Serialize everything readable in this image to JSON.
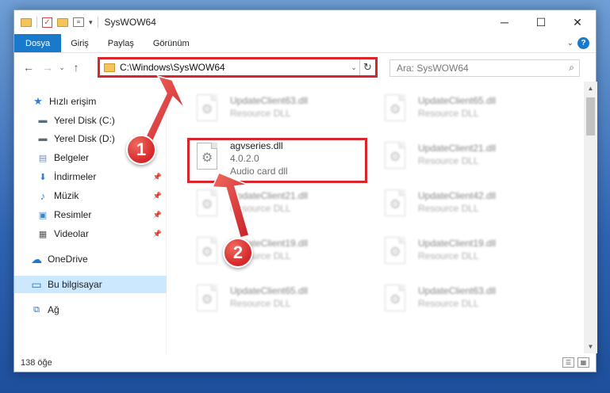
{
  "window": {
    "title": "SysWOW64",
    "controls": {
      "minimize": "─",
      "maximize": "☐",
      "close": "✕"
    }
  },
  "quick_access_toolbar": {
    "props": "≡",
    "caret": "▾"
  },
  "ribbon": {
    "tabs": [
      "Dosya",
      "Giriş",
      "Paylaş",
      "Görünüm"
    ],
    "expand": "⌄",
    "help": "?"
  },
  "navigation": {
    "back": "←",
    "forward": "→",
    "recent": "⌄",
    "up": "↑",
    "address": "C:\\Windows\\SysWOW64",
    "address_caret": "⌄",
    "refresh": "↻",
    "search_placeholder": "Ara: SysWOW64",
    "search_icon": "⌕"
  },
  "sidebar": {
    "items": [
      {
        "label": "Hızlı erişim",
        "icon": "star-icon",
        "glyph": "★"
      },
      {
        "label": "Yerel Disk (C:)",
        "icon": "drive-icon",
        "glyph": "▬"
      },
      {
        "label": "Yerel Disk (D:)",
        "icon": "drive-icon",
        "glyph": "▬"
      },
      {
        "label": "Belgeler",
        "icon": "documents-icon",
        "glyph": "▤"
      },
      {
        "label": "İndirmeler",
        "icon": "downloads-icon",
        "glyph": "⬇"
      },
      {
        "label": "Müzik",
        "icon": "music-icon",
        "glyph": "♪"
      },
      {
        "label": "Resimler",
        "icon": "pictures-icon",
        "glyph": "▣"
      },
      {
        "label": "Videolar",
        "icon": "videos-icon",
        "glyph": "▦"
      },
      {
        "label": "OneDrive",
        "icon": "cloud-icon",
        "glyph": "☁"
      },
      {
        "label": "Bu bilgisayar",
        "icon": "computer-icon",
        "glyph": "▭"
      },
      {
        "label": "Ağ",
        "icon": "network-icon",
        "glyph": "⧉"
      }
    ],
    "pin_glyph": "📌"
  },
  "files": {
    "highlighted": {
      "name": "agvseries.dll",
      "version": "4.0.2.0",
      "description": "Audio card dll"
    },
    "blurred": [
      {
        "name": "UpdateClient63.dll",
        "description": "Resource DLL"
      },
      {
        "name": "UpdateClient65.dll",
        "description": "Resource DLL"
      },
      {
        "name": "UpdateClient21.dll",
        "description": "Resource DLL"
      },
      {
        "name": "UpdateClient21.dll",
        "description": "Resource DLL"
      },
      {
        "name": "UpdateClient42.dll",
        "description": "Resource DLL"
      },
      {
        "name": "UpdateClient19.dll",
        "description": "Resource DLL"
      },
      {
        "name": "UpdateClient19.dll",
        "description": "Resource DLL"
      },
      {
        "name": "UpdateClient65.dll",
        "description": "Resource DLL"
      },
      {
        "name": "UpdateClient63.dll",
        "description": "Resource DLL"
      }
    ],
    "gear_glyph": "⚙"
  },
  "scrollbar": {
    "up": "▲",
    "down": "▼"
  },
  "status": {
    "count": "138 öğe",
    "details_view": "☰",
    "tiles_view": "▦"
  },
  "callouts": {
    "step1": "1",
    "step2": "2"
  },
  "colors": {
    "accent": "#1979ca",
    "highlight": "#d9262a",
    "selection": "#cce8ff"
  }
}
